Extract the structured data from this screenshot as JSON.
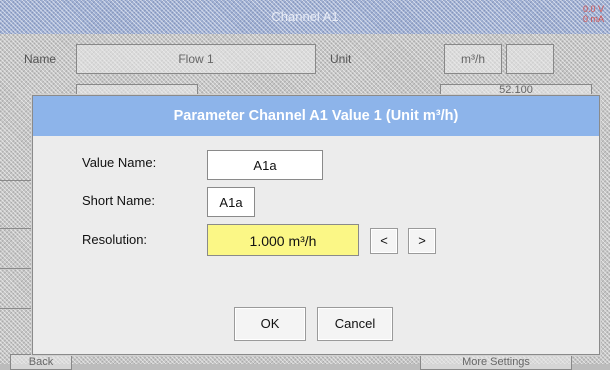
{
  "background": {
    "title": "Channel A1",
    "status_line1": "0.0 V",
    "status_line2": "0 mA",
    "name_label": "Name",
    "name_value": "Flow 1",
    "unit_label": "Unit",
    "unit_value": "m³/h",
    "range_value": "52.100",
    "bottom_left_label": "Back",
    "bottom_right_button": "More Settings"
  },
  "dialog": {
    "title": "Parameter Channel A1 Value 1 (Unit m³/h)",
    "value_name_label": "Value Name:",
    "value_name_value": "A1a",
    "short_name_label": "Short Name:",
    "short_name_value": "A1a",
    "resolution_label": "Resolution:",
    "resolution_value": "1.000 m³/h",
    "decrease_label": "<",
    "increase_label": ">",
    "ok_label": "OK",
    "cancel_label": "Cancel"
  },
  "colors": {
    "title_bar": "#8db4ea",
    "resolution_field": "#fbf786"
  }
}
